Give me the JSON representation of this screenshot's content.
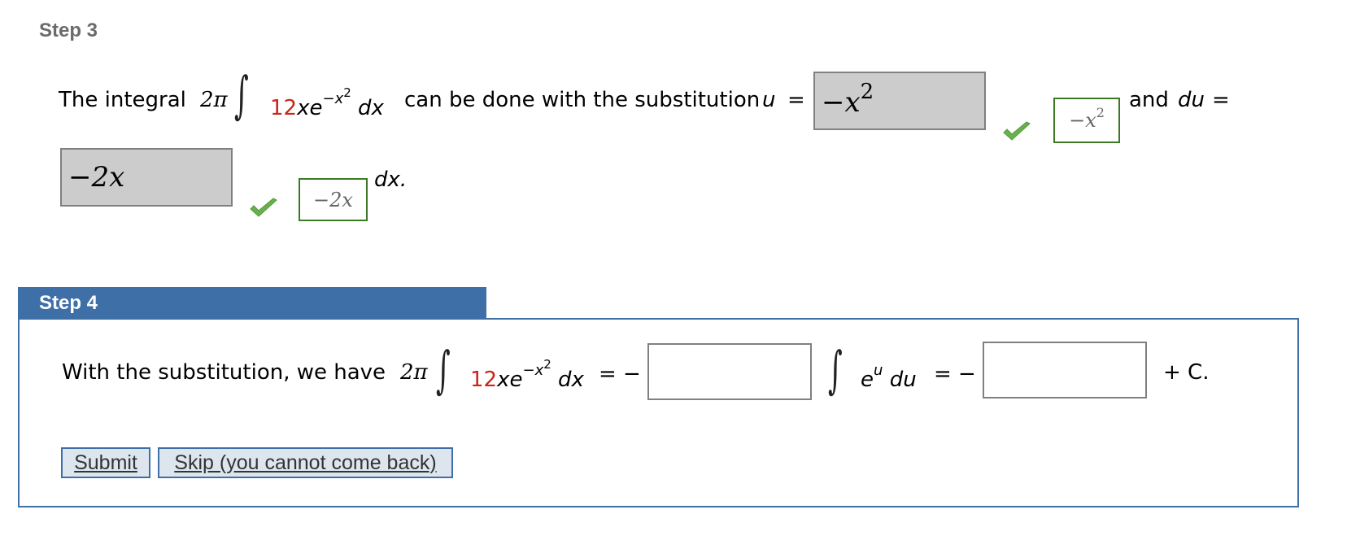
{
  "step3": {
    "title": "Step 3",
    "intro": "The integral",
    "coef": "2π",
    "integrand_coef": "12",
    "integrand_body": "xe",
    "exponent": "−x",
    "exponent_power": "2",
    "dx": "dx",
    "mid_text": "can be done with the substitution",
    "u_label": "u",
    "equals": "=",
    "u_input_value": "−x",
    "u_input_power": "2",
    "u_check": "checkmark-icon",
    "u_preview": "−x",
    "u_preview_power": "2",
    "and_text": "and",
    "du_label": "du",
    "du_input_value": "−2x",
    "du_check": "checkmark-icon",
    "du_preview": "−2x",
    "dx_end": "dx."
  },
  "step4": {
    "title": "Step 4",
    "intro": "With the substitution, we have",
    "coef": "2π",
    "integrand_coef": "12",
    "integrand_body": "xe",
    "exponent": "−x",
    "exponent_power": "2",
    "dx": "dx",
    "eq_minus_1": "= −",
    "input1_value": "",
    "eu": "e",
    "eu_power": "u",
    "du": "du",
    "eq_minus_2": "= −",
    "input2_value": "",
    "plus_c": "+ C."
  },
  "buttons": {
    "submit": "Submit",
    "skip": "Skip (you cannot come back)"
  },
  "colors": {
    "accent": "#3f6fa7",
    "highlight_red": "#cc2418",
    "correct_green": "#3b7a23"
  }
}
